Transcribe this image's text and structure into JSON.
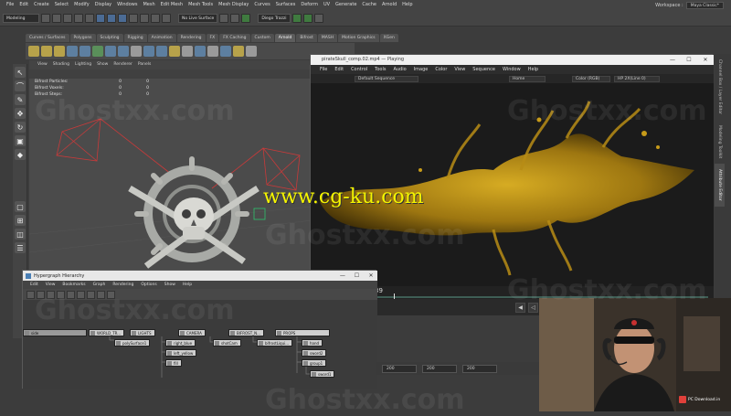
{
  "maya": {
    "menubar": [
      "File",
      "Edit",
      "Create",
      "Select",
      "Modify",
      "Display",
      "Windows",
      "Mesh",
      "Edit Mesh",
      "Mesh Tools",
      "Mesh Display",
      "Curves",
      "Surfaces",
      "Deform",
      "UV",
      "Generate",
      "Cache",
      "Arnold",
      "Help"
    ],
    "workspace_label": "Workspace :",
    "workspace_value": "Maya Classic*",
    "mode_select": "Modeling",
    "live_surface": "No Live Surface",
    "user": "Diego Trazzi",
    "shelf_tabs": [
      "Curves / Surfaces",
      "Polygons",
      "Sculpting",
      "Rigging",
      "Animation",
      "Rendering",
      "FX",
      "FX Caching",
      "Custom",
      "Arnold",
      "Bifrost",
      "MASH",
      "Motion Graphics",
      "XGen"
    ],
    "shelf_active": "Arnold",
    "viewport_menu": [
      "View",
      "Shading",
      "Lighting",
      "Show",
      "Renderer",
      "Panels"
    ],
    "hud": [
      {
        "label": "Bifrost Particles:",
        "a": "0",
        "b": "0"
      },
      {
        "label": "Bifrost Voxels:",
        "a": "0",
        "b": "0"
      },
      {
        "label": "Bifrost Steps:",
        "a": "0",
        "b": "0"
      }
    ],
    "range": [
      "200",
      "200",
      "200"
    ]
  },
  "rv": {
    "title": "pirateSkull_comp.02.mp4 — Playing",
    "menu": [
      "File",
      "Edit",
      "Control",
      "Tools",
      "Audio",
      "Image",
      "Color",
      "View",
      "Sequence",
      "Window",
      "Help"
    ],
    "sequence": "Default Sequence",
    "view_mode": "Home",
    "color_space": "Color (RGB)",
    "zoom": "HP 2X(Line 0)",
    "frame_left": "39",
    "frame_count": "294 frames",
    "frame_current": "39",
    "progress": 0.13
  },
  "right_tabs": [
    "Channel Box / Layer Editor",
    "Modeling Toolkit",
    "Attribute Editor"
  ],
  "hypergraph": {
    "title": "Hypergraph Hierarchy",
    "menu": [
      "Edit",
      "View",
      "Bookmarks",
      "Graph",
      "Rendering",
      "Options",
      "Show",
      "Help"
    ],
    "nodes": {
      "root1": "side",
      "world": "WORLD_TR...",
      "lights": "LIGHTS",
      "camera": "CAMERA",
      "bifrost": "BIFROST_N...",
      "props": "PROPS",
      "polySurface": "polySurface1",
      "light_blue": "right_blue",
      "left_yellow": "left_yellow",
      "fill": "fill",
      "shotCam": "shotCam",
      "bifrostLiquid": "bifrostLiqui...",
      "hand": "hand",
      "sword2": "sword2",
      "group1": "group1",
      "sword1": "sword1"
    }
  },
  "watermarks": {
    "ghost": "Ghostxx.com",
    "cgku": "www.cg-ku.com",
    "badge": "PC Download.in"
  },
  "colors": {
    "liquid": "#c9a11a",
    "cgku": "#f5f500",
    "arnold_tab": "#5d5d5d"
  }
}
